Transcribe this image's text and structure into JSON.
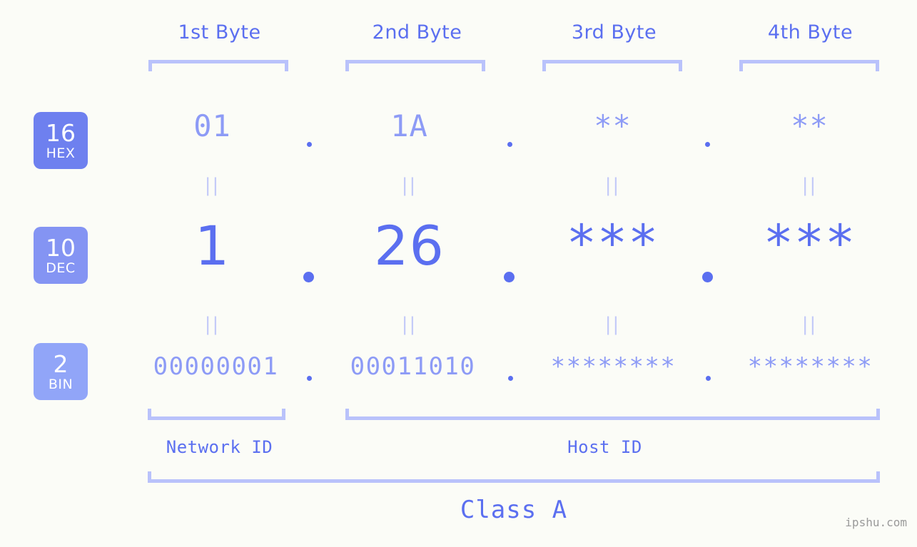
{
  "meta": {
    "background_color": "#fbfcf7",
    "accent_strong": "#5b6ff0",
    "accent_light": "#8d9bf6",
    "accent_pale": "#b9c2fb"
  },
  "byte_headers": [
    {
      "label": "1st Byte"
    },
    {
      "label": "2nd Byte"
    },
    {
      "label": "3rd Byte"
    },
    {
      "label": "4th Byte"
    }
  ],
  "radix_badges": [
    {
      "number": "16",
      "name": "HEX",
      "color": "#6e80ef"
    },
    {
      "number": "10",
      "name": "DEC",
      "color": "#8494f3"
    },
    {
      "number": "2",
      "name": "BIN",
      "color": "#91a5f8"
    }
  ],
  "rows": {
    "hex": {
      "values": [
        "01",
        "1A",
        "**",
        "**"
      ]
    },
    "dec": {
      "values": [
        "1",
        "26",
        "***",
        "***"
      ]
    },
    "bin": {
      "values": [
        "00000001",
        "00011010",
        "********",
        "********"
      ]
    }
  },
  "separators": {
    "hex": [
      ".",
      ".",
      "."
    ],
    "dec": [
      ".",
      ".",
      "."
    ],
    "bin": [
      ".",
      ".",
      "."
    ]
  },
  "equals_marks": {
    "symbol": "||",
    "rows": 2,
    "columns": 4
  },
  "sections": [
    {
      "label": "Network ID"
    },
    {
      "label": "Host ID"
    }
  ],
  "class": {
    "label": "Class A"
  },
  "watermark": {
    "text": "ipshu.com"
  }
}
